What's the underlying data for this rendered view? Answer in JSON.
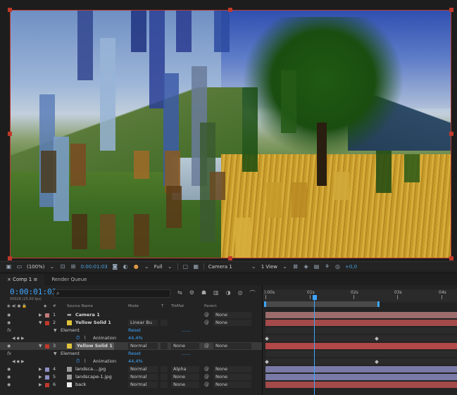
{
  "viewer": {
    "zoom": "(100%)",
    "timecode": "0:00:01:03",
    "resolution": "Full",
    "camera": "Camera 1",
    "view": "1 View",
    "exposure": "+0,0"
  },
  "tabs": [
    {
      "label": "Comp 1",
      "active": true
    },
    {
      "label": "Render Queue",
      "active": false
    }
  ],
  "timeline": {
    "timecode": "0:00:01:03",
    "subtime": "00028 (25.00 fps)",
    "search_placeholder": "",
    "columns": {
      "source_name": "Source Name",
      "mode": "Mode",
      "t": "T",
      "trkmat": "TrkMat",
      "parent": "Parent"
    },
    "ruler": [
      "):00s",
      "01s",
      "02s",
      "03s",
      "04s"
    ],
    "layers": [
      {
        "num": "1",
        "name": "Camera 1",
        "color": "#c47a7a",
        "mode": "",
        "trkmat": "",
        "parent": "None"
      },
      {
        "num": "2",
        "name": "Yellow Solid 1",
        "color": "#e0c33a",
        "mode": "Linear Bu",
        "trkmat": "",
        "parent": "None"
      },
      {
        "num": "3",
        "name": "Yellow Solid 1",
        "color": "#c0392b",
        "mode": "Normal",
        "trkmat": "None",
        "parent": "None"
      },
      {
        "num": "4",
        "name": "landsca....jpg",
        "color": "#8f8fc4",
        "mode": "Normal",
        "trkmat": "Alpha",
        "parent": "None"
      },
      {
        "num": "5",
        "name": "landscape-1.jpg",
        "color": "#8f8fc4",
        "mode": "Normal",
        "trkmat": "None",
        "parent": "None"
      },
      {
        "num": "6",
        "name": "back",
        "color": "#c0392b",
        "mode": "Normal",
        "trkmat": "None",
        "parent": "None"
      }
    ],
    "fx": {
      "fx_label": "fx",
      "element_label": "Element",
      "reset_label": "Reset",
      "dots": "......",
      "animation_label": "Animation",
      "animation_value": "44,4%"
    }
  },
  "colors": {
    "accent": "#3ea6ff",
    "handle": "#c0392b"
  }
}
